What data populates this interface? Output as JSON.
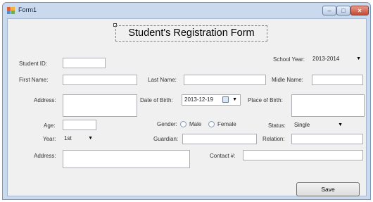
{
  "window": {
    "title": "Form1"
  },
  "form": {
    "heading": "Student's Registration Form",
    "labels": {
      "student_id": "Student ID:",
      "school_year": "School Year:",
      "first_name": "First Name:",
      "last_name": "Last Name:",
      "middle_name": "Midle Name:",
      "address": "Address:",
      "date_of_birth": "Date of Birth:",
      "place_of_birth": "Place of Birth:",
      "age": "Age:",
      "gender": "Gender:",
      "male": "Male",
      "female": "Female",
      "status": "Status:",
      "year": "Year:",
      "guardian": "Guardian:",
      "relation": "Relation:",
      "address2": "Address:",
      "contact": "Contact #:"
    },
    "values": {
      "school_year": "2013-2014",
      "date_of_birth": "2013-12-19",
      "status": "Single",
      "year": "1st"
    },
    "save_label": "Save"
  }
}
